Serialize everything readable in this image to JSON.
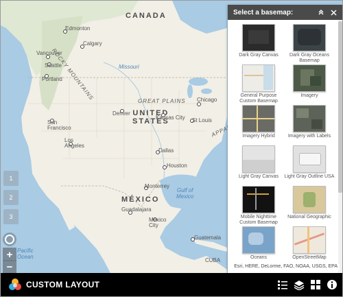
{
  "map": {
    "labels": {
      "canada": "CANADA",
      "united_states": "UNITED\nSTATES",
      "mexico": "MÉXICO",
      "great_plains": "GREAT PLAINS",
      "rocky": "ROCKY MOUNTAINS",
      "appalach": "APPALA",
      "gulf": "Gulf of\nMexico",
      "pacific": "Pacific\nOcean",
      "missouri": "Missouri",
      "cuba": "CUBA",
      "edmonton": "Edmonton",
      "calgary": "Calgary",
      "vancouver": "Vancouver",
      "seattle": "Seattle",
      "portland": "Portland",
      "sanfrancisco": "San\nFrancisco",
      "losangeles": "Los\nAngeles",
      "denver": "Denver",
      "kansascity": "Kansas City",
      "chicago": "Chicago",
      "stlouis": "St Louis",
      "dallas": "Dallas",
      "houston": "Houston",
      "monterrey": "Monterrey",
      "guadalajara": "Guadalajara",
      "mexicocity": "Mexico\nCity",
      "guatemala": "Guatemala"
    },
    "controls": {
      "btn1": "1",
      "btn2": "2",
      "btn3": "3",
      "zoom_in": "+",
      "zoom_out": "−"
    },
    "attribution": "Esri, HERE, DeLorme, FAO, NOAA, USGS, EPA"
  },
  "basemap_panel": {
    "title": "Select a basemap:",
    "items": [
      {
        "label": "Dark Gray Canvas"
      },
      {
        "label": "Dark Gray Oceans Basemap"
      },
      {
        "label": "General Purpose Custom Basemap"
      },
      {
        "label": "Imagery"
      },
      {
        "label": "Imagery Hybrid"
      },
      {
        "label": "Imagery with Labels"
      },
      {
        "label": "Light Gray Canvas"
      },
      {
        "label": "Light Gray Outline USA"
      },
      {
        "label": "Mobile Nighttime Custom Basemap"
      },
      {
        "label": "National Geographic"
      },
      {
        "label": "Oceans"
      },
      {
        "label": "OpenStreetMap"
      }
    ]
  },
  "bottom_bar": {
    "app_title": "CUSTOM LAYOUT"
  },
  "colors": {
    "header_bg": "#4a4a4a",
    "bar_bg": "#000000",
    "water": "#a9cbe4",
    "land": "#f2efe6"
  }
}
